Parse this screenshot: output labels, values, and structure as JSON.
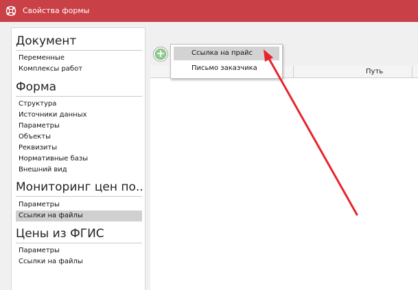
{
  "window": {
    "title": "Свойства формы"
  },
  "sidebar": {
    "sections": [
      {
        "title": "Документ",
        "items": [
          "Переменные",
          "Комплексы работ"
        ]
      },
      {
        "title": "Форма",
        "items": [
          "Структура",
          "Источники данных",
          "Параметры",
          "Объекты",
          "Реквизиты",
          "Нормативные базы",
          "Внешний вид"
        ]
      },
      {
        "title": "Мониторинг цен по...",
        "items": [
          "Параметры",
          "Ссылки на файлы"
        ]
      },
      {
        "title": "Цены из ФГИС",
        "items": [
          "Параметры",
          "Ссылки на файлы"
        ]
      }
    ],
    "selected": "Ссылки на файлы"
  },
  "table": {
    "columns": [
      "Путь"
    ]
  },
  "add_menu": {
    "items": [
      "Ссылка на прайс",
      "Письмо заказчика"
    ],
    "highlighted": "Ссылка на прайс"
  },
  "colors": {
    "titlebar": "#c94046",
    "annotation_arrow": "#e8232a",
    "add_button": "#8fcf8a"
  },
  "icons": {
    "app": "app-logo-icon",
    "add": "add-plus-icon"
  }
}
